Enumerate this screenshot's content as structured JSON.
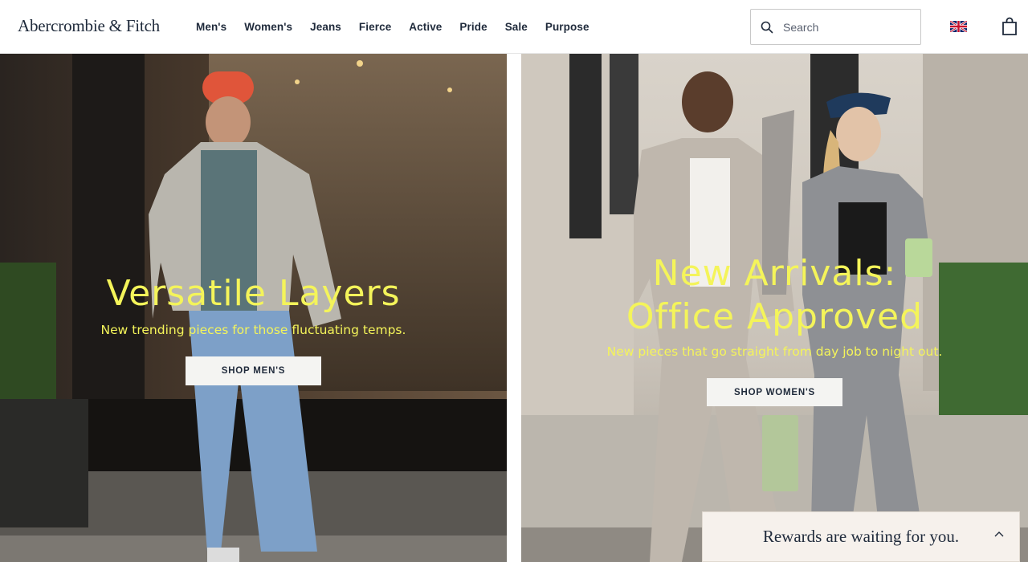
{
  "brand": {
    "logo_text": "Abercrombie & Fitch"
  },
  "nav": {
    "items": [
      {
        "label": "Men's"
      },
      {
        "label": "Women's"
      },
      {
        "label": "Jeans"
      },
      {
        "label": "Fierce"
      },
      {
        "label": "Active"
      },
      {
        "label": "Pride"
      },
      {
        "label": "Sale"
      },
      {
        "label": "Purpose"
      }
    ]
  },
  "search": {
    "placeholder": "Search",
    "value": ""
  },
  "header_icons": {
    "region": "uk-flag-icon",
    "cart": "shopping-bag-icon"
  },
  "hero_left": {
    "title": "Versatile Layers",
    "subtitle": "New trending pieces for those fluctuating temps.",
    "cta_label": "SHOP MEN'S"
  },
  "hero_right": {
    "title_line1": "New Arrivals:",
    "title_line2": "Office Approved",
    "subtitle": "New pieces that go straight from day job to night out.",
    "cta_label": "SHOP WOMEN'S"
  },
  "rewards": {
    "text": "Rewards are waiting for you.",
    "icon": "chevron-up-icon"
  },
  "colors": {
    "accent_text": "#f4f45a",
    "nav_text": "#1f2a3b",
    "cta_bg": "#f4f4f2",
    "rewards_bg": "#f6f1ec"
  }
}
